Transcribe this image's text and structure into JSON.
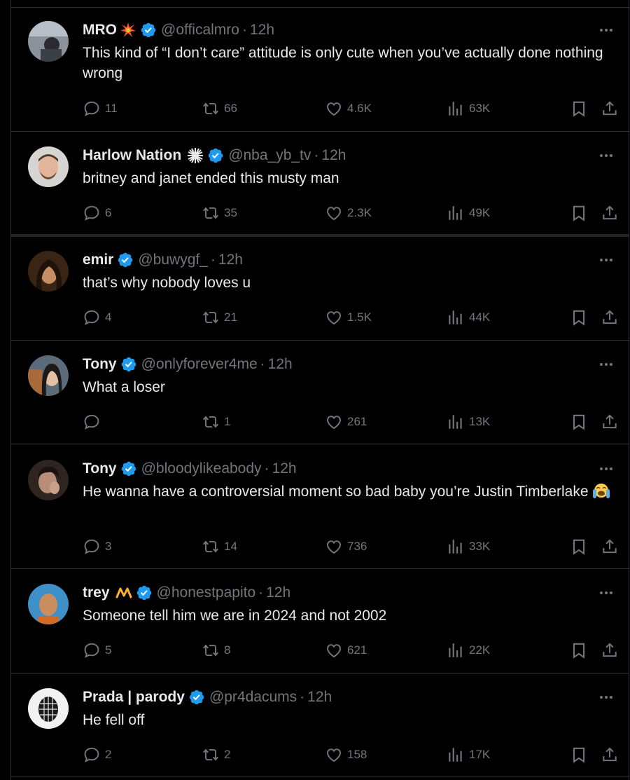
{
  "colors": {
    "background": "#000000",
    "text": "#e7e9ea",
    "muted": "#71767b",
    "verified": "#1d9bf0",
    "divider": "#2f3336"
  },
  "tweets": [
    {
      "name": "MRO",
      "badge": "collision-emoji",
      "handle": "@officalmro",
      "time": "12h",
      "text": "This kind of “I don’t care” attitude is only cute when you’ve actually done nothing wrong",
      "replies": "11",
      "retweets": "66",
      "likes": "4.6K",
      "views": "63K"
    },
    {
      "name": "Harlow Nation",
      "badge": "white-burst-emoji",
      "handle": "@nba_yb_tv",
      "time": "12h",
      "text": "britney and janet ended this musty man",
      "replies": "6",
      "retweets": "35",
      "likes": "2.3K",
      "views": "49K"
    },
    {
      "name": "emir",
      "badge": "",
      "handle": "@buwygf_",
      "time": "12h",
      "text": "that’s why nobody loves u",
      "replies": "4",
      "retweets": "21",
      "likes": "1.5K",
      "views": "44K"
    },
    {
      "name": "Tony",
      "badge": "",
      "handle": "@onlyforever4me",
      "time": "12h",
      "text": "What a loser",
      "replies": "",
      "retweets": "1",
      "likes": "261",
      "views": "13K"
    },
    {
      "name": "Tony",
      "badge": "",
      "handle": "@bloodylikeabody",
      "time": "12h",
      "text": "He wanna have a controversial moment so bad baby you’re Justin Timberlake",
      "text_emoji": "loudly-crying-emoji",
      "replies": "3",
      "retweets": "14",
      "likes": "736",
      "views": "33K"
    },
    {
      "name": "trey",
      "badge": "crown-squiggle-emoji",
      "handle": "@honestpapito",
      "time": "12h",
      "text": "Someone tell him we are in 2024 and not 2002",
      "replies": "5",
      "retweets": "8",
      "likes": "621",
      "views": "22K"
    },
    {
      "name": "Prada | parody",
      "badge": "",
      "handle": "@pr4dacums",
      "time": "12h",
      "text": "He fell off",
      "replies": "2",
      "retweets": "2",
      "likes": "158",
      "views": "17K"
    }
  ]
}
